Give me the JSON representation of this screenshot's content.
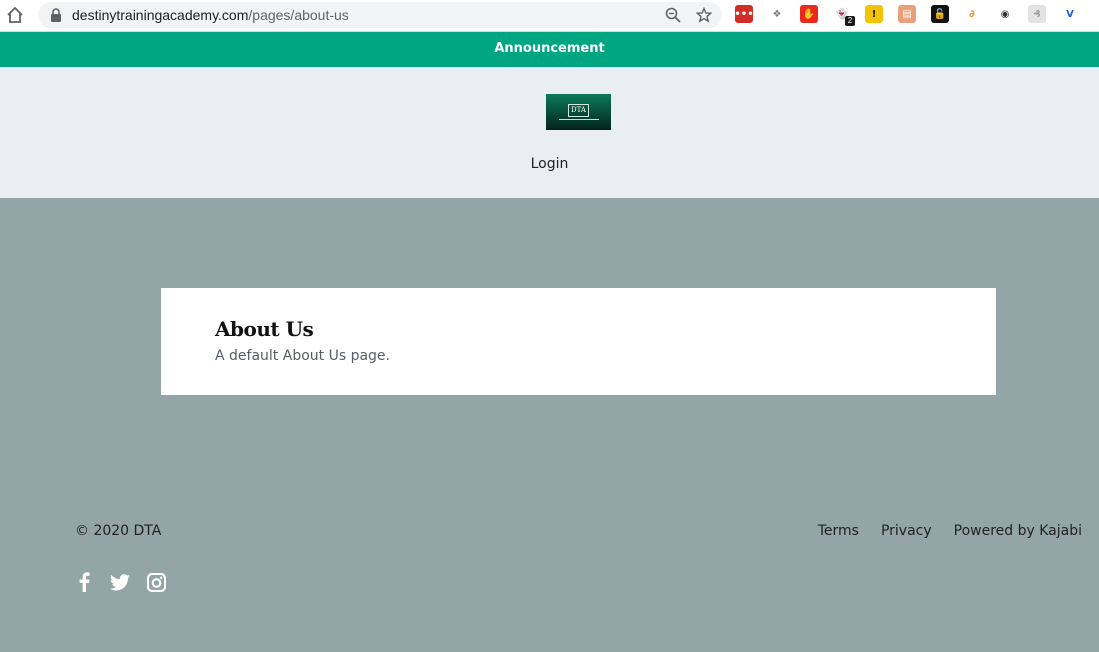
{
  "browser": {
    "url_domain": "destinytrainingacademy.com",
    "url_path": "/pages/about-us",
    "icons": {
      "home": "home-icon",
      "lock": "lock-icon",
      "zoom": "zoom-out-icon",
      "bookmark": "star-icon"
    },
    "extensions": [
      {
        "name": "lastpass-extension-icon",
        "glyph": "•••",
        "color": "#d32d27"
      },
      {
        "name": "dropbox-extension-icon",
        "glyph": "❖",
        "color": "#ffffff",
        "fg": "#7b7b7b"
      },
      {
        "name": "adblock-extension-icon",
        "glyph": "✋",
        "color": "#e8291c"
      },
      {
        "name": "ghostery-extension-icon",
        "glyph": "👻",
        "color": "#ffffff",
        "fg": "#00aef0"
      },
      {
        "name": "warning-extension-icon",
        "glyph": "!",
        "color": "#f5c400",
        "fg": "#111"
      },
      {
        "name": "printer-extension-icon",
        "glyph": "▤",
        "color": "#e8a17a"
      },
      {
        "name": "lock-extension-icon",
        "glyph": "🔓",
        "color": "#111111"
      },
      {
        "name": "grammar-extension-icon",
        "glyph": "∂",
        "color": "#ffffff",
        "fg": "#f08a24"
      },
      {
        "name": "mask-extension-icon",
        "glyph": "◉",
        "color": "#ffffff",
        "fg": "#333"
      },
      {
        "name": "lamp-extension-icon",
        "glyph": "₰",
        "color": "#e3e3e3",
        "fg": "#999"
      },
      {
        "name": "v-extension-icon",
        "glyph": "V",
        "color": "#ffffff",
        "fg": "#1d5fd3"
      },
      {
        "name": "profile-extension-icon",
        "glyph": "◔",
        "color": "#ffffff",
        "fg": "#777"
      }
    ],
    "ghostery_badge": "2"
  },
  "announcement": {
    "text": "Announcement",
    "bg": "#00a682"
  },
  "header": {
    "logo_text": "DTA",
    "login_label": "Login"
  },
  "main": {
    "title": "About Us",
    "description": "A default About Us page."
  },
  "footer": {
    "copyright": "© 2020 DTA",
    "links": [
      "Terms",
      "Privacy",
      "Powered by Kajabi"
    ],
    "social_icons": [
      "facebook-icon",
      "twitter-icon",
      "instagram-icon"
    ]
  }
}
